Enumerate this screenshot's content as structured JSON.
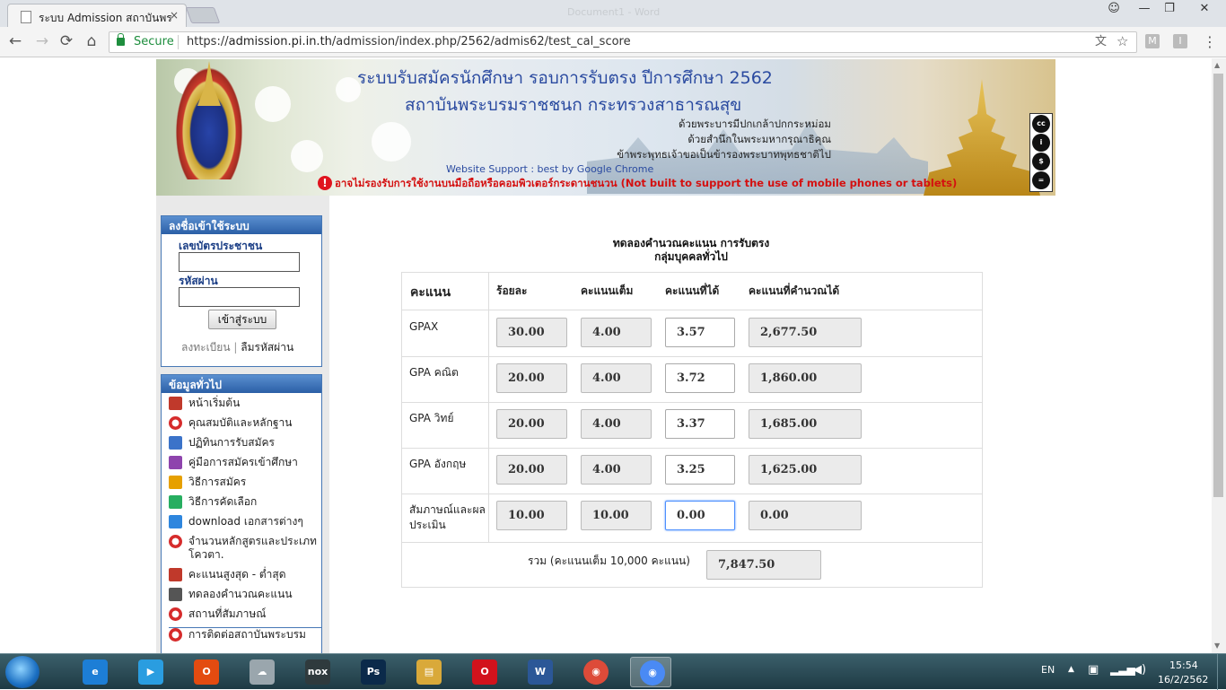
{
  "browser": {
    "tab_title": "ระบบ Admission สถาบันพร",
    "tab_close": "×",
    "window_title_faded": "Document1 - Word",
    "nav": {
      "back": "←",
      "forward": "→",
      "reload": "⟳",
      "home": "⌂"
    },
    "secure_label": "Secure",
    "url_scheme": "https://",
    "url_host": "admission.pi.in.th",
    "url_path": "/admission/index.php/2562/admis62/test_cal_score",
    "ext_m": "M",
    "ext_i": "I",
    "menu_glyph": "⋮",
    "translate_glyph": "文",
    "star_glyph": "☆"
  },
  "banner": {
    "title_line1": "ระบบรับสมัครนักศึกษา รอบการรับตรง ปีการศึกษา 2562",
    "title_line2": "สถาบันพระบรมราชชนก กระทรวงสาธารณสุข",
    "verse1": "ด้วยพระบารมีปกเกล้าปกกระหม่อม",
    "verse2": "ด้วยสำนึกในพระมหากรุณาธิคุณ",
    "verse3": "ข้าพระพุทธเจ้าขอเป็นข้ารองพระบาทพุทธชาติไป",
    "support": "Website Support : best by Google Chrome",
    "warning_icon": "!",
    "warning": "อาจไม่รองรับการใช้งานบนมือถือหรือคอมพิวเตอร์กระดานชนวน (Not built to support the use of mobile phones or tablets)",
    "cc_icons": [
      "cc",
      "i",
      "$",
      "="
    ]
  },
  "login": {
    "heading": "ลงชื่อเข้าใช้ระบบ",
    "id_label": "เลขบัตรประชาชน",
    "password_label": "รหัสผ่าน",
    "submit": "เข้าสู่ระบบ",
    "register": "ลงทะเบียน",
    "divider": "|",
    "forgot": "ลืมรหัสผ่าน"
  },
  "info": {
    "heading": "ข้อมูลทั่วไป",
    "items": [
      {
        "label": "หน้าเริ่มต้น",
        "icon": "home-icon",
        "color": "#c0392b"
      },
      {
        "label": "คุณสมบัติและหลักฐาน",
        "icon": "lifebuoy-icon",
        "color": "#d62c2c"
      },
      {
        "label": "ปฏิทินการรับสมัคร",
        "icon": "calendar-icon",
        "color": "#3b73c9"
      },
      {
        "label": "คู่มือการสมัครเข้าศึกษา",
        "icon": "books-icon",
        "color": "#8e44ad"
      },
      {
        "label": "วิธีการสมัคร",
        "icon": "pencil-icon",
        "color": "#e6a000"
      },
      {
        "label": "วิธีการคัดเลือก",
        "icon": "arrows-icon",
        "color": "#27ae60"
      },
      {
        "label": "download เอกสารต่างๆ",
        "icon": "window-icon",
        "color": "#2e86de"
      },
      {
        "label": "จำนวนหลักสูตรและประเภทโควตา.",
        "icon": "lifebuoy-icon",
        "color": "#d62c2c"
      },
      {
        "label": "คะแนนสูงสุด - ต่ำสุด",
        "icon": "calendar-icon",
        "color": "#c0392b"
      },
      {
        "label": "ทดลองคำนวณคะแนน",
        "icon": "calculator-icon",
        "color": "#555555"
      },
      {
        "label": "สถานที่สัมภาษณ์",
        "icon": "lifebuoy-icon",
        "color": "#d62c2c"
      },
      {
        "label": "การติดต่อสถาบันพระบรม",
        "icon": "lifebuoy-icon",
        "color": "#d62c2c"
      }
    ]
  },
  "main": {
    "title": "ทดลองคำนวณคะแนน การรับตรง",
    "subtitle": "กลุ่มบุคคลทั่วไป",
    "headers": {
      "score": "คะแนน",
      "percent": "ร้อยละ",
      "full": "คะแนนเต็ม",
      "got": "คะแนนที่ได้",
      "calc": "คะแนนที่คำนวณได้"
    },
    "rows": [
      {
        "label": "GPAX",
        "percent": "30.00",
        "full": "4.00",
        "got": "3.57",
        "calc": "2,677.50"
      },
      {
        "label": "GPA คณิต",
        "percent": "20.00",
        "full": "4.00",
        "got": "3.72",
        "calc": "1,860.00"
      },
      {
        "label": "GPA วิทย์",
        "percent": "20.00",
        "full": "4.00",
        "got": "3.37",
        "calc": "1,685.00"
      },
      {
        "label": "GPA อังกฤษ",
        "percent": "20.00",
        "full": "4.00",
        "got": "3.25",
        "calc": "1,625.00"
      },
      {
        "label": "สัมภาษณ์และผลประเมิน",
        "percent": "10.00",
        "full": "10.00",
        "got": "0.00",
        "calc": "0.00"
      }
    ],
    "total_label": "รวม (คะแนนเต็ม 10,000 คะแนน)",
    "total_value": "7,847.50"
  },
  "taskbar": {
    "lang": "EN",
    "time": "15:54",
    "date": "16/2/2562",
    "apps": [
      {
        "name": "ie-icon",
        "glyph": "e",
        "color": "#1d7ed6"
      },
      {
        "name": "media-player-icon",
        "glyph": "▶",
        "color": "#2a9de0"
      },
      {
        "name": "office-icon",
        "glyph": "O",
        "color": "#e34b10"
      },
      {
        "name": "cloud-app-icon",
        "glyph": "☁",
        "color": "#9aa6ad"
      },
      {
        "name": "nox-icon",
        "glyph": "nox",
        "color": "#2f3a3d"
      },
      {
        "name": "photoshop-icon",
        "glyph": "Ps",
        "color": "#0b2a4a"
      },
      {
        "name": "file-explorer-icon",
        "glyph": "▤",
        "color": "#d9a93a"
      },
      {
        "name": "opera-icon",
        "glyph": "O",
        "color": "#d2121c"
      },
      {
        "name": "word-icon",
        "glyph": "W",
        "color": "#2b5797"
      },
      {
        "name": "chrome-icon",
        "glyph": "◉",
        "color": "#dd4b39"
      },
      {
        "name": "chrome-active-icon",
        "glyph": "◉",
        "color": "#4a8af4"
      }
    ]
  }
}
